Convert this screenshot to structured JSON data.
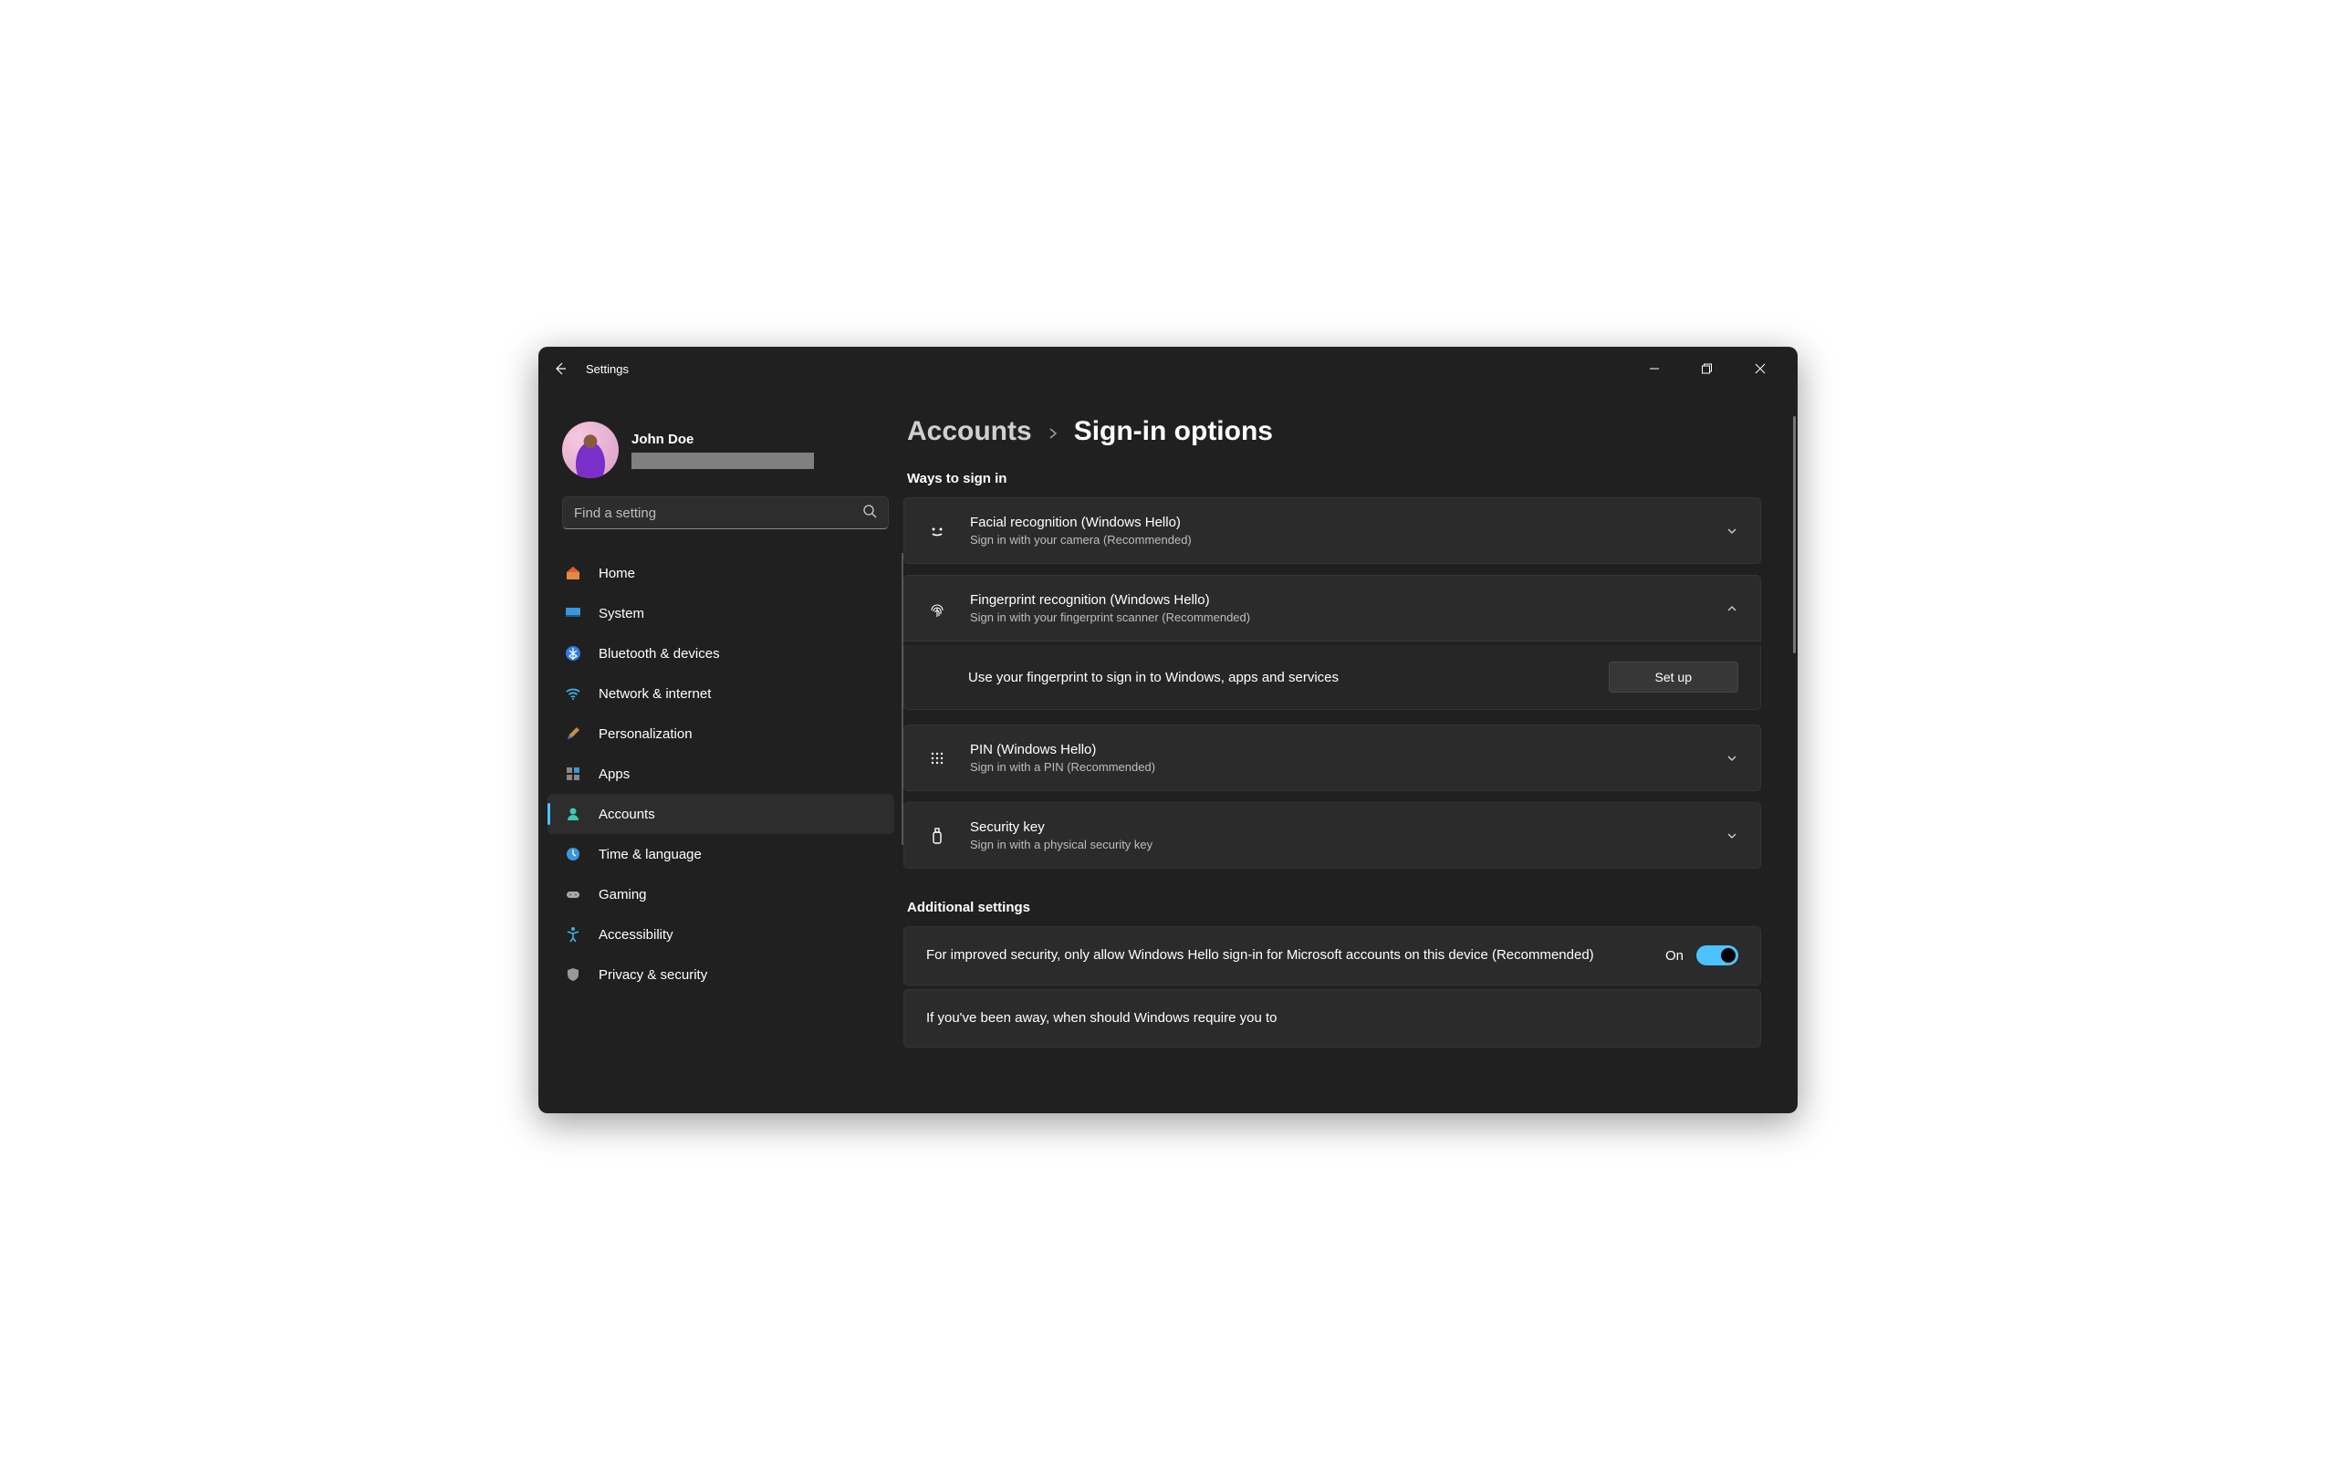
{
  "window": {
    "title": "Settings"
  },
  "profile": {
    "name": "John Doe"
  },
  "search": {
    "placeholder": "Find a setting"
  },
  "nav": {
    "items": [
      {
        "label": "Home"
      },
      {
        "label": "System"
      },
      {
        "label": "Bluetooth & devices"
      },
      {
        "label": "Network & internet"
      },
      {
        "label": "Personalization"
      },
      {
        "label": "Apps"
      },
      {
        "label": "Accounts"
      },
      {
        "label": "Time & language"
      },
      {
        "label": "Gaming"
      },
      {
        "label": "Accessibility"
      },
      {
        "label": "Privacy & security"
      }
    ],
    "active_index": 6
  },
  "breadcrumb": {
    "parent": "Accounts",
    "current": "Sign-in options"
  },
  "ways": {
    "section_title": "Ways to sign in",
    "items": [
      {
        "title": "Facial recognition (Windows Hello)",
        "sub": "Sign in with your camera (Recommended)",
        "expanded": false
      },
      {
        "title": "Fingerprint recognition (Windows Hello)",
        "sub": "Sign in with your fingerprint scanner (Recommended)",
        "expanded": true,
        "expansion": {
          "desc": "Use your fingerprint to sign in to Windows, apps and services",
          "button": "Set up"
        }
      },
      {
        "title": "PIN (Windows Hello)",
        "sub": "Sign in with a PIN (Recommended)",
        "expanded": false
      },
      {
        "title": "Security key",
        "sub": "Sign in with a physical security key",
        "expanded": false
      }
    ]
  },
  "additional": {
    "section_title": "Additional settings",
    "rows": [
      {
        "desc": "For improved security, only allow Windows Hello sign-in for Microsoft accounts on this device (Recommended)",
        "toggle": {
          "label": "On",
          "value": true
        }
      },
      {
        "desc": "If you've been away, when should Windows require you to"
      }
    ]
  }
}
